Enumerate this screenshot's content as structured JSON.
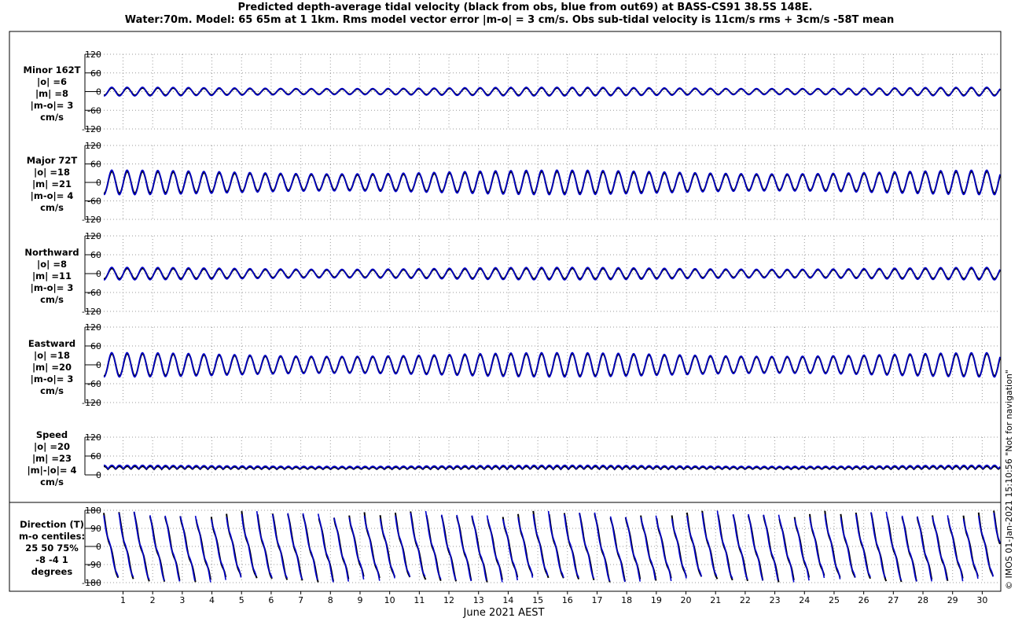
{
  "title_line1": "Predicted depth-average tidal velocity (black from obs, blue from out69) at BASS-CS91 38.5S 148E.",
  "title_line2": "Water:70m. Model: 65 65m at 1 1km. Rms model vector error |m-o| = 3 cm/s. Obs sub-tidal velocity is 11cm/s rms + 3cm/s -58T mean",
  "xlabel": "June 2021 AEST",
  "watermark": "© IMOS 01-Jan-2021 15:10:56  \"Not for navigation\"",
  "colors": {
    "obs": "#000000",
    "model": "#0000cc",
    "grid": "#999999"
  },
  "chart_data": [
    {
      "type": "line",
      "panel": "minor",
      "label_lines": [
        "Minor 162T",
        "|o| =6",
        "|m| =8",
        "|m-o|= 3",
        "cm/s"
      ],
      "ylim": [
        -120,
        120
      ],
      "yticks": [
        -120,
        -60,
        0,
        60,
        120
      ],
      "xlim": [
        0.35,
        30.6
      ],
      "xticks": [
        1,
        2,
        3,
        4,
        5,
        6,
        7,
        8,
        9,
        10,
        11,
        12,
        13,
        14,
        15,
        16,
        17,
        18,
        19,
        20,
        21,
        22,
        23,
        24,
        25,
        26,
        27,
        28,
        29,
        30
      ],
      "series": [
        {
          "name": "obs",
          "amplitude": 10,
          "mean": 0
        },
        {
          "name": "out69",
          "amplitude": 12,
          "mean": 0
        }
      ]
    },
    {
      "type": "line",
      "panel": "major",
      "label_lines": [
        "Major 72T",
        "|o| =18",
        "|m| =21",
        "|m-o|= 4",
        "cm/s"
      ],
      "ylim": [
        -120,
        120
      ],
      "yticks": [
        -120,
        -60,
        0,
        60,
        120
      ],
      "xlim": [
        0.35,
        30.6
      ],
      "series": [
        {
          "name": "obs",
          "amplitude": 30,
          "mean": 0
        },
        {
          "name": "out69",
          "amplitude": 34,
          "mean": 0
        }
      ]
    },
    {
      "type": "line",
      "panel": "northward",
      "label_lines": [
        "Northward",
        "|o| =8",
        "|m| =11",
        "|m-o|= 3",
        "cm/s"
      ],
      "ylim": [
        -120,
        120
      ],
      "yticks": [
        -120,
        -60,
        0,
        60,
        120
      ],
      "xlim": [
        0.35,
        30.6
      ],
      "series": [
        {
          "name": "obs",
          "amplitude": 14,
          "mean": 0
        },
        {
          "name": "out69",
          "amplitude": 17,
          "mean": 0
        }
      ]
    },
    {
      "type": "line",
      "panel": "eastward",
      "label_lines": [
        "Eastward",
        "|o| =18",
        "|m| =20",
        "|m-o|= 3",
        "cm/s"
      ],
      "ylim": [
        -120,
        120
      ],
      "yticks": [
        -120,
        -60,
        0,
        60,
        120
      ],
      "xlim": [
        0.35,
        30.6
      ],
      "series": [
        {
          "name": "obs",
          "amplitude": 30,
          "mean": 0
        },
        {
          "name": "out69",
          "amplitude": 33,
          "mean": 0
        }
      ]
    },
    {
      "type": "line",
      "panel": "speed",
      "label_lines": [
        "Speed",
        "|o| =20",
        "|m| =23",
        "|m|-|o|= 4",
        "cm/s"
      ],
      "ylim": [
        0,
        120
      ],
      "yticks": [
        0,
        60,
        120
      ],
      "xlim": [
        0.35,
        30.6
      ],
      "series": [
        {
          "name": "obs",
          "amplitude": 8,
          "mean": 20
        },
        {
          "name": "out69",
          "amplitude": 10,
          "mean": 22
        }
      ]
    },
    {
      "type": "line",
      "panel": "direction",
      "label_lines": [
        "Direction (T)",
        "m-o centiles:",
        "25  50  75%",
        "-8  -4  1",
        "degrees"
      ],
      "ylim": [
        -180,
        180
      ],
      "yticks": [
        -180,
        -90,
        0,
        90,
        180
      ],
      "xlim": [
        0.35,
        30.6
      ],
      "series": [
        {
          "name": "obs",
          "wrap": "sawtooth"
        },
        {
          "name": "out69",
          "wrap": "sawtooth"
        }
      ]
    }
  ]
}
